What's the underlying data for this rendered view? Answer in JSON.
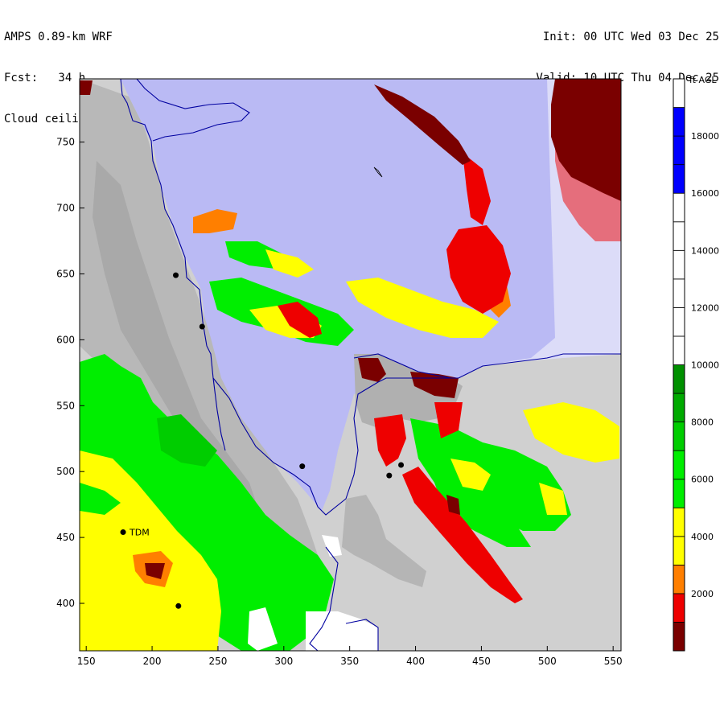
{
  "header": {
    "model": "AMPS 0.89-km WRF",
    "forecast": "Fcst:   34 h",
    "field": "Cloud ceiling (ft AGL)",
    "init": "Init: 00 UTC Wed 03 Dec 25",
    "valid": "Valid: 10 UTC Thu 04 Dec 25"
  },
  "map": {
    "x_ticks": [
      150,
      200,
      250,
      300,
      350,
      400,
      450,
      500,
      550
    ],
    "y_ticks": [
      400,
      450,
      500,
      550,
      600,
      650,
      700,
      750
    ],
    "xlim": [
      145,
      556
    ],
    "ylim": [
      364,
      798
    ],
    "stations": [
      {
        "x": 218,
        "y": 649,
        "label": ""
      },
      {
        "x": 238,
        "y": 610,
        "label": ""
      },
      {
        "x": 314,
        "y": 504,
        "label": ""
      },
      {
        "x": 380,
        "y": 497,
        "label": ""
      },
      {
        "x": 389,
        "y": 505,
        "label": ""
      },
      {
        "x": 178,
        "y": 454,
        "label": "TDM"
      },
      {
        "x": 220,
        "y": 398,
        "label": ""
      }
    ]
  },
  "colorbar": {
    "unit": "ft AGL",
    "labels": [
      "2000",
      "4000",
      "6000",
      "8000",
      "10000",
      "12000",
      "14000",
      "16000",
      "18000"
    ],
    "bins": [
      {
        "from": 0,
        "to": 1000,
        "color": "#7a0000"
      },
      {
        "from": 1000,
        "to": 2000,
        "color": "#ee0000"
      },
      {
        "from": 2000,
        "to": 3000,
        "color": "#ff7f00"
      },
      {
        "from": 3000,
        "to": 4000,
        "color": "#ffff00"
      },
      {
        "from": 4000,
        "to": 5000,
        "color": "#ffff00"
      },
      {
        "from": 5000,
        "to": 6000,
        "color": "#00ee00"
      },
      {
        "from": 6000,
        "to": 7000,
        "color": "#00ee00"
      },
      {
        "from": 7000,
        "to": 8000,
        "color": "#00cd00"
      },
      {
        "from": 8000,
        "to": 9000,
        "color": "#00aa00"
      },
      {
        "from": 9000,
        "to": 10000,
        "color": "#009000"
      },
      {
        "from": 10000,
        "to": 11000,
        "color": "#ffffff"
      },
      {
        "from": 11000,
        "to": 12000,
        "color": "#ffffff"
      },
      {
        "from": 12000,
        "to": 13000,
        "color": "#ffffff"
      },
      {
        "from": 13000,
        "to": 14000,
        "color": "#ffffff"
      },
      {
        "from": 14000,
        "to": 15000,
        "color": "#ffffff"
      },
      {
        "from": 15000,
        "to": 16000,
        "color": "#ffffff"
      },
      {
        "from": 16000,
        "to": 17000,
        "color": "#0000ff"
      },
      {
        "from": 17000,
        "to": 18000,
        "color": "#0000ff"
      },
      {
        "from": 18000,
        "to": 19000,
        "color": "#0000ff"
      },
      {
        "from": 19000,
        "to": 20000,
        "color": "#ffffff"
      }
    ]
  },
  "colors": {
    "sea_ice": "#babaf4",
    "open_shelf": "#dcdcf8",
    "terrain": "#d0d0d0",
    "coast": "#0000a0"
  }
}
